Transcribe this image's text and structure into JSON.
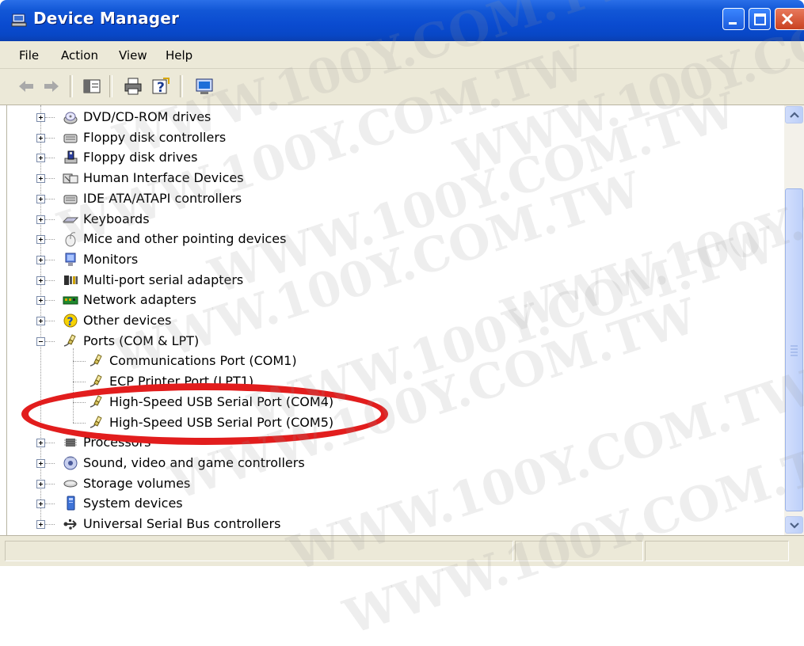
{
  "window": {
    "title": "Device Manager"
  },
  "menu": [
    "File",
    "Action",
    "View",
    "Help"
  ],
  "toolbar": [
    {
      "icon": "back-arrow-icon"
    },
    {
      "icon": "forward-arrow-icon"
    },
    {
      "icon": "show-hide-console-tree-icon"
    },
    {
      "icon": "print-icon"
    },
    {
      "icon": "help-icon"
    },
    {
      "icon": "properties-monitor-icon"
    }
  ],
  "tree": [
    {
      "label": "DVD/CD-ROM drives",
      "icon": "cd-drive-icon",
      "level": 0,
      "expander": "plus"
    },
    {
      "label": "Floppy disk controllers",
      "icon": "controller-icon",
      "level": 0,
      "expander": "plus"
    },
    {
      "label": "Floppy disk drives",
      "icon": "floppy-drive-icon",
      "level": 0,
      "expander": "plus"
    },
    {
      "label": "Human Interface Devices",
      "icon": "hid-icon",
      "level": 0,
      "expander": "plus"
    },
    {
      "label": "IDE ATA/ATAPI controllers",
      "icon": "controller-icon",
      "level": 0,
      "expander": "plus"
    },
    {
      "label": "Keyboards",
      "icon": "keyboard-icon",
      "level": 0,
      "expander": "plus"
    },
    {
      "label": "Mice and other pointing devices",
      "icon": "mouse-icon",
      "level": 0,
      "expander": "plus"
    },
    {
      "label": "Monitors",
      "icon": "monitor-icon",
      "level": 0,
      "expander": "plus"
    },
    {
      "label": "Multi-port serial adapters",
      "icon": "serial-adapter-icon",
      "level": 0,
      "expander": "plus"
    },
    {
      "label": "Network adapters",
      "icon": "network-card-icon",
      "level": 0,
      "expander": "plus"
    },
    {
      "label": "Other devices",
      "icon": "unknown-device-icon",
      "level": 0,
      "expander": "plus"
    },
    {
      "label": "Ports (COM & LPT)",
      "icon": "port-connector-icon",
      "level": 0,
      "expander": "minus"
    },
    {
      "label": "Communications Port (COM1)",
      "icon": "port-connector-icon",
      "level": 1
    },
    {
      "label": "ECP Printer Port (LPT1)",
      "icon": "port-connector-icon",
      "level": 1
    },
    {
      "label": "High-Speed USB Serial Port (COM4)",
      "icon": "port-connector-icon",
      "level": 1
    },
    {
      "label": "High-Speed USB Serial Port (COM5)",
      "icon": "port-connector-icon",
      "level": 1
    },
    {
      "label": "Processors",
      "icon": "processor-icon",
      "level": 0,
      "expander": "plus"
    },
    {
      "label": "Sound, video and game controllers",
      "icon": "sound-icon",
      "level": 0,
      "expander": "plus"
    },
    {
      "label": "Storage volumes",
      "icon": "storage-volume-icon",
      "level": 0,
      "expander": "plus"
    },
    {
      "label": "System devices",
      "icon": "system-device-icon",
      "level": 0,
      "expander": "plus"
    },
    {
      "label": "Universal Serial Bus controllers",
      "icon": "usb-icon",
      "level": 0,
      "expander": "plus"
    }
  ],
  "watermark": "WWW.100Y.COM.TW",
  "colors": {
    "titlebar": "#0a4bd0",
    "highlight_ellipse": "#e21d1d",
    "chrome": "#ece9d8"
  }
}
